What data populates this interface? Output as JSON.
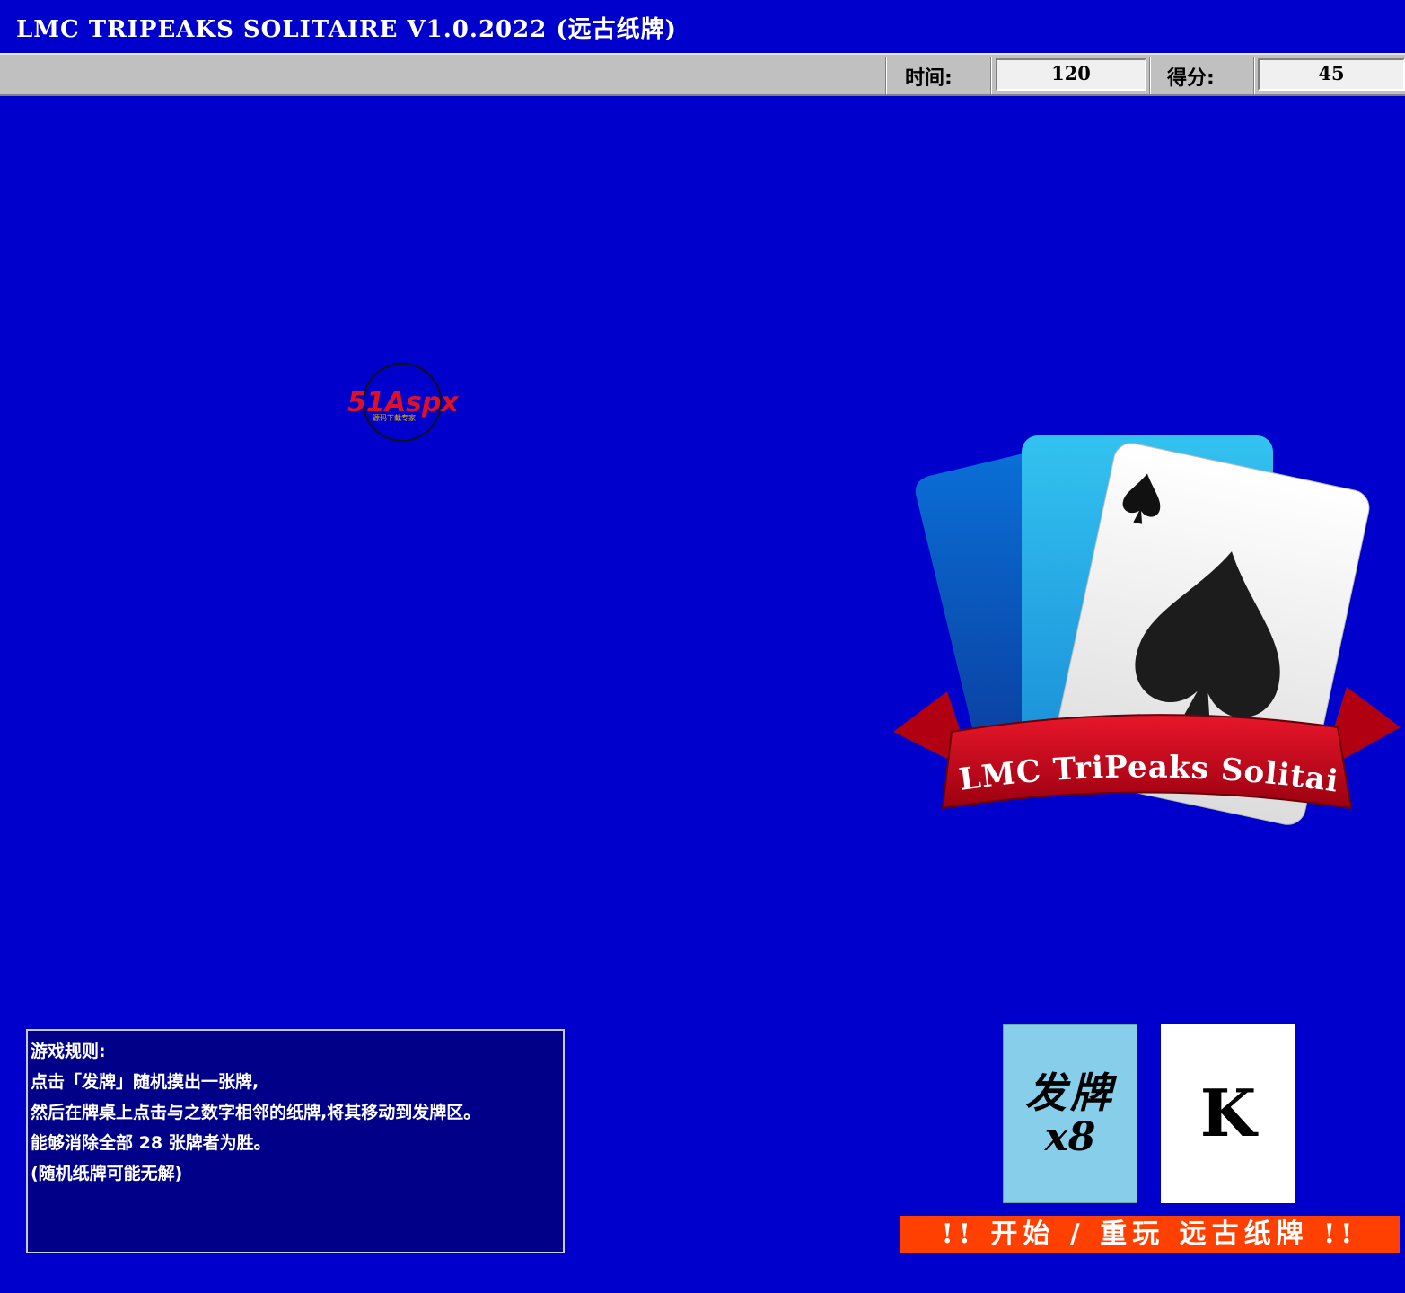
{
  "window": {
    "title": "LMC TRIPEAKS SOLITAIRE  V1.0.2022 (远古纸牌)"
  },
  "status": {
    "time_label": "时间:",
    "time_value": "120",
    "score_label": "得分:",
    "score_value": "45"
  },
  "watermark": {
    "text": "51Aspx",
    "subtext": "源码下载专家"
  },
  "logo": {
    "banner_text": "LMC TriPeaks Solitaire"
  },
  "rules": {
    "lines": [
      "游戏规则:",
      "点击「发牌」随机摸出一张牌,",
      "然后在牌桌上点击与之数字相邻的纸牌,将其移动到发牌区。",
      "能够消除全部 28 张牌者为胜。",
      "(随机纸牌可能无解)"
    ]
  },
  "deck": {
    "label": "发牌",
    "remaining": "x8"
  },
  "current_card": {
    "rank": "K"
  },
  "start_button": {
    "label": "!! 开始 / 重玩 远古纸牌 !!"
  },
  "colors": {
    "table": "#0000cc",
    "rules_bg": "#000088",
    "deck_card": "#87ceeb",
    "start_button": "#ff4000",
    "ribbon_red": "#cc0010",
    "card_blue_light": "#29b6e8",
    "card_blue_dark": "#0a5fbf"
  },
  "icons": {
    "logo_suit": "spade-icon"
  }
}
